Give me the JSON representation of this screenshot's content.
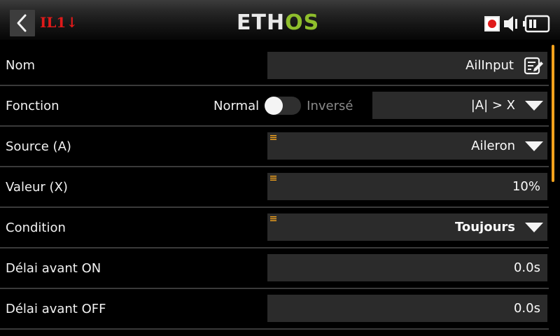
{
  "header": {
    "model_id": "IL1",
    "model_arrow": "↓",
    "logo_left": "ETH",
    "logo_right": "OS",
    "icons": [
      "back-chevron-icon",
      "record-icon",
      "speaker-icon",
      "battery-icon"
    ]
  },
  "colors": {
    "accent_orange": "#f2a21d",
    "logo_green": "#8fbe2c",
    "model_red": "#e01a1a",
    "field_bg": "#2b2b2b"
  },
  "rows": {
    "nom": {
      "label": "Nom",
      "value": "AilInput"
    },
    "fonction": {
      "label": "Fonction",
      "normal_label": "Normal",
      "inverse_label": "Inversé",
      "inverted": false,
      "value": "|A| > X"
    },
    "source": {
      "label": "Source (A)",
      "value": "Aileron"
    },
    "valeur": {
      "label": "Valeur (X)",
      "value": "10%"
    },
    "condition": {
      "label": "Condition",
      "value": "Toujours"
    },
    "delai_on": {
      "label": "Délai avant ON",
      "value": "0.0s"
    },
    "delai_off": {
      "label": "Délai avant OFF",
      "value": "0.0s"
    }
  }
}
